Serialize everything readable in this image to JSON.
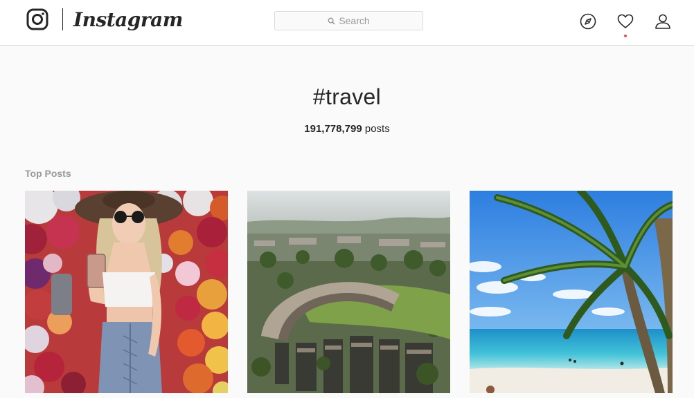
{
  "app": {
    "name": "Instagram"
  },
  "search": {
    "placeholder": "Search"
  },
  "nav": {
    "icons": [
      "compass-icon",
      "heart-icon",
      "profile-icon"
    ],
    "has_notification": true
  },
  "hashtag": {
    "title": "#travel",
    "post_count": "191,778,799",
    "post_count_label": "posts"
  },
  "sections": {
    "top_posts_label": "Top Posts"
  },
  "posts": [
    {
      "depicts": "photo-woman-flower-wall"
    },
    {
      "depicts": "photo-aerial-city-crescent"
    },
    {
      "depicts": "photo-beach-palm-tree"
    }
  ],
  "colors": {
    "notification": "#ed4956",
    "border": "#dbdbdb",
    "text": "#262626",
    "muted": "#999999"
  }
}
